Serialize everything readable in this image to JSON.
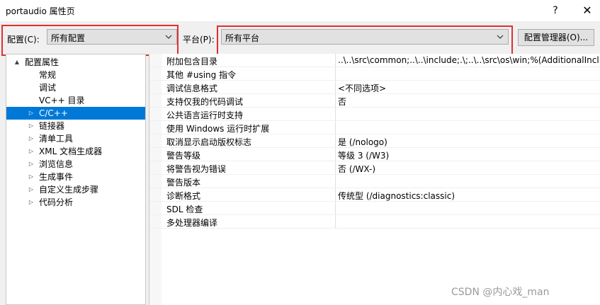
{
  "window": {
    "title": "portaudio 属性页",
    "help_label": "?",
    "close_label": "✕"
  },
  "toolbar": {
    "config_label": "配置(C):",
    "config_value": "所有配置",
    "platform_label": "平台(P):",
    "platform_value": "所有平台",
    "config_manager_label": "配置管理器(O)..."
  },
  "tree": {
    "items": [
      {
        "label": "配置属性",
        "expander": "▲"
      },
      {
        "label": "常规",
        "expander": ""
      },
      {
        "label": "调试",
        "expander": ""
      },
      {
        "label": "VC++ 目录",
        "expander": ""
      },
      {
        "label": "C/C++",
        "expander": "▷",
        "selected": true
      },
      {
        "label": "链接器",
        "expander": "▷"
      },
      {
        "label": "清单工具",
        "expander": "▷"
      },
      {
        "label": "XML 文档生成器",
        "expander": "▷"
      },
      {
        "label": "浏览信息",
        "expander": "▷"
      },
      {
        "label": "生成事件",
        "expander": "▷"
      },
      {
        "label": "自定义生成步骤",
        "expander": "▷"
      },
      {
        "label": "代码分析",
        "expander": "▷"
      }
    ]
  },
  "properties": [
    {
      "name": "附加包含目录",
      "value": "..\\..\\src\\common;..\\..\\include;.\\;..\\..\\src\\os\\win;%(AdditionalIncl"
    },
    {
      "name": "其他 #using 指令",
      "value": ""
    },
    {
      "name": "调试信息格式",
      "value": "<不同选项>"
    },
    {
      "name": "支持仅我的代码调试",
      "value": "否"
    },
    {
      "name": "公共语言运行时支持",
      "value": ""
    },
    {
      "name": "使用 Windows 运行时扩展",
      "value": ""
    },
    {
      "name": "取消显示启动版权标志",
      "value": "是 (/nologo)"
    },
    {
      "name": "警告等级",
      "value": "等级 3 (/W3)"
    },
    {
      "name": "将警告视为错误",
      "value": "否 (/WX-)"
    },
    {
      "name": "警告版本",
      "value": ""
    },
    {
      "name": "诊断格式",
      "value": "传统型 (/diagnostics:classic)"
    },
    {
      "name": "SDL 检查",
      "value": ""
    },
    {
      "name": "多处理器编译",
      "value": ""
    }
  ],
  "watermark": "CSDN @内心戏_man",
  "colors": {
    "highlight": "#e03030",
    "selection": "#0078d7"
  }
}
